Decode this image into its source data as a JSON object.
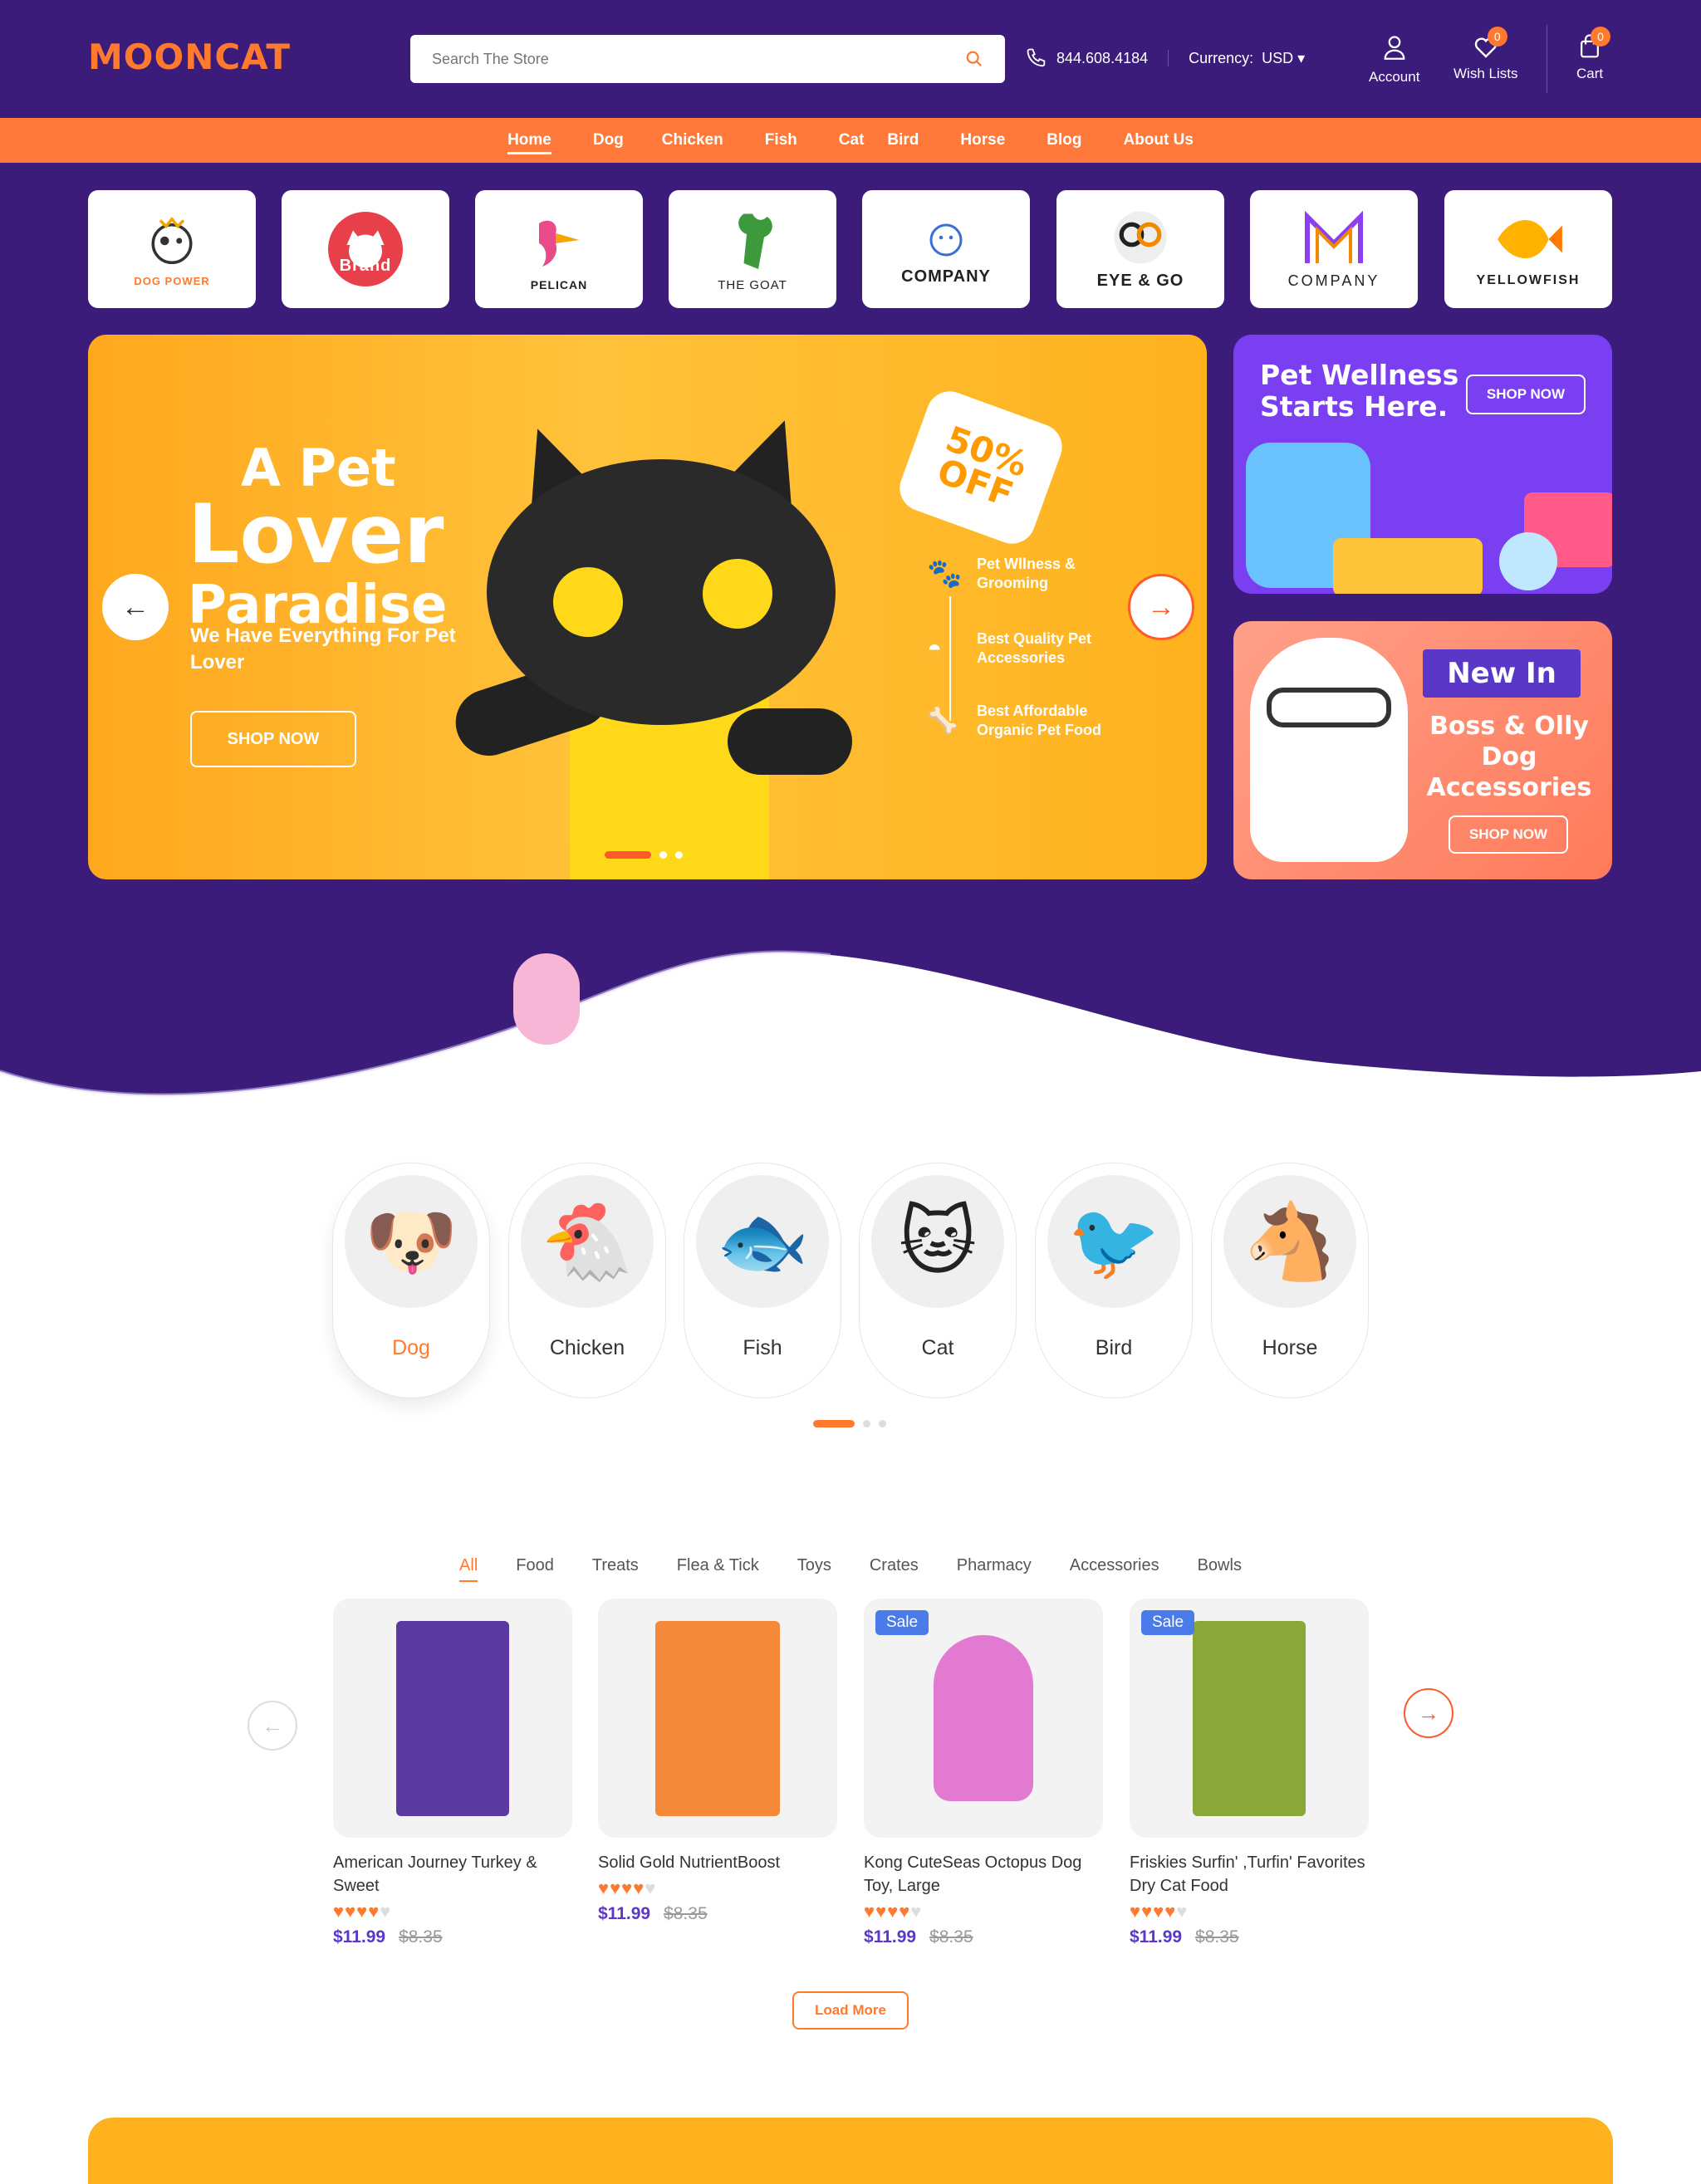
{
  "header": {
    "logo": "MOONCAT",
    "search_placeholder": "Search The Store",
    "phone": "844.608.4184",
    "currency_label": "Currency:",
    "currency_value": "USD",
    "account_label": "Account",
    "wishlist_label": "Wish Lists",
    "wishlist_count": "0",
    "cart_label": "Cart",
    "cart_count": "0"
  },
  "nav": {
    "items": [
      "Home",
      "Dog",
      "Chicken",
      "Fish",
      "Cat",
      "Bird",
      "Horse",
      "Blog",
      "About Us"
    ],
    "active": "Home"
  },
  "brands": [
    "DOG POWER",
    "Brand",
    "PELICAN",
    "THE GOAT",
    "COMPANY",
    "EYE & GO",
    "COMPANY",
    "YELLOWFISH"
  ],
  "hero": {
    "title_line1": "A Pet",
    "title_line2": "Lover",
    "title_line3": "Paradise",
    "subtitle": "We Have Everything For Pet Lover",
    "cta": "SHOP NOW",
    "badge": "50% OFF",
    "features": [
      "Pet Wllness & Grooming",
      "Best Quality Pet Accessories",
      "Best Affordable Organic Pet Food"
    ]
  },
  "promo1": {
    "title": "Pet Wellness Starts Here.",
    "cta": "SHOP NOW"
  },
  "promo2": {
    "tag": "New In",
    "title": "Boss & Olly Dog Accessories",
    "cta": "SHOP NOW"
  },
  "categories": [
    "Dog",
    "Chicken",
    "Fish",
    "Cat",
    "Bird",
    "Horse"
  ],
  "product_tabs": {
    "items": [
      "All",
      "Food",
      "Treats",
      "Flea & Tick",
      "Toys",
      "Crates",
      "Pharmacy",
      "Accessories",
      "Bowls"
    ],
    "active": "All"
  },
  "products": [
    {
      "name": "American Journey Turkey & Sweet",
      "price": "$11.99",
      "old_price": "$8.35",
      "rating": 4,
      "sale": ""
    },
    {
      "name": "Solid Gold NutrientBoost",
      "price": "$11.99",
      "old_price": "$8.35",
      "rating": 4,
      "sale": ""
    },
    {
      "name": "Kong CuteSeas Octopus Dog Toy, Large",
      "price": "$11.99",
      "old_price": "$8.35",
      "rating": 4,
      "sale": "Sale"
    },
    {
      "name": "Friskies Surfin' ,Turfin' Favorites Dry Cat Food",
      "price": "$11.99",
      "old_price": "$8.35",
      "rating": 4,
      "sale": "Sale"
    }
  ],
  "load_more": "Load More",
  "colors": {
    "primary": "#3b1c7a",
    "accent": "#ff7a2f",
    "hero": "#ffb21e",
    "price": "#5b37c8"
  }
}
